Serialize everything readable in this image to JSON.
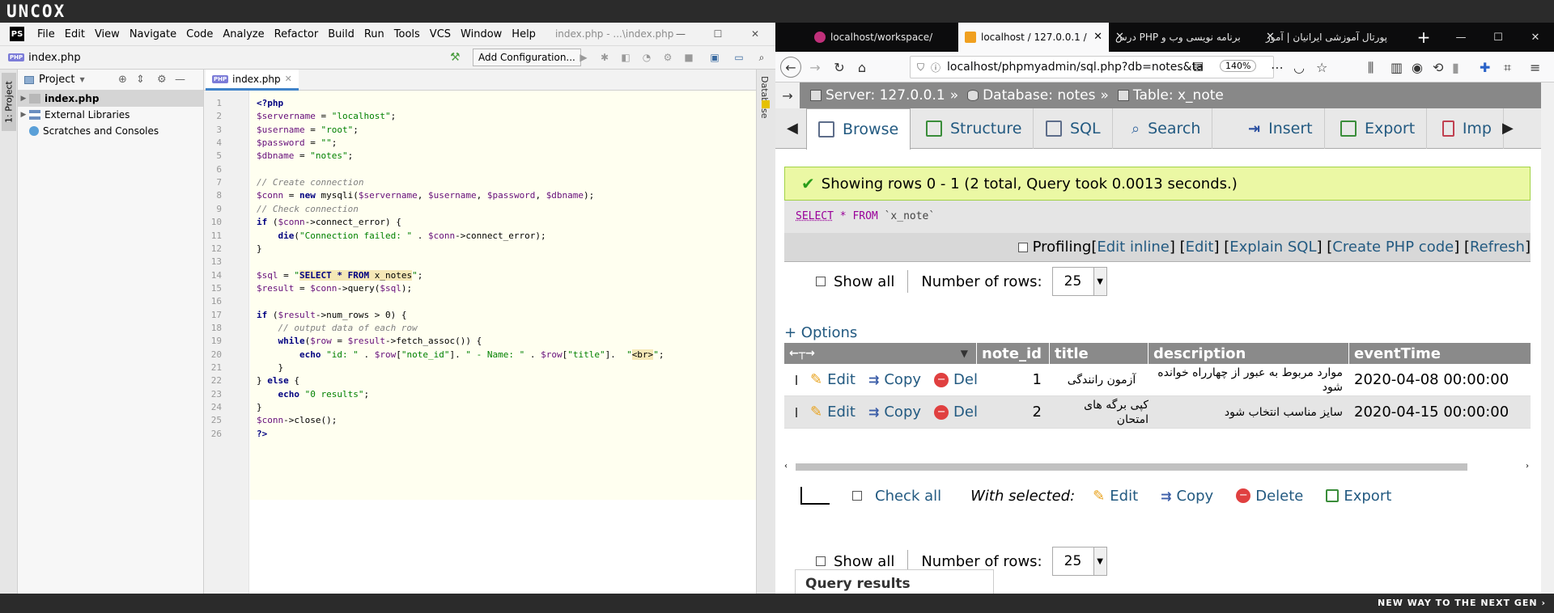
{
  "brand": {
    "logo": "UNCOX",
    "tagline": "NEW WAY TO THE NEXT GEN ›"
  },
  "ide": {
    "menu": [
      "File",
      "Edit",
      "View",
      "Navigate",
      "Code",
      "Analyze",
      "Refactor",
      "Build",
      "Run",
      "Tools",
      "VCS",
      "Window",
      "Help"
    ],
    "title": "index.php - ...\\index.php",
    "breadcrumb_file": "index.php",
    "add_config_label": "Add Configuration...",
    "side_tab_label": "1: Project",
    "project_header": "Project",
    "tree": [
      "index.php",
      "External Libraries",
      "Scratches and Consoles"
    ],
    "editor_tab": "index.php",
    "right_tab_label": "Database",
    "php_badge": "PHP",
    "code_lines": [
      "<?php",
      "$servername = \"localhost\";",
      "$username = \"root\";",
      "$password = \"\";",
      "$dbname = \"notes\";",
      "",
      "// Create connection",
      "$conn = new mysqli($servername, $username, $password, $dbname);",
      "// Check connection",
      "if ($conn->connect_error) {",
      "    die(\"Connection failed: \" . $conn->connect_error);",
      "}",
      "",
      "$sql = \"SELECT * FROM x_notes\";",
      "$result = $conn->query($sql);",
      "",
      "if ($result->num_rows > 0) {",
      "    // output data of each row",
      "    while($row = $result->fetch_assoc()) {",
      "        echo \"id: \" . $row[\"note_id\"]. \" - Name: \" . $row[\"title\"].  \"<br>\";",
      "    }",
      "} else {",
      "    echo \"0 results\";",
      "}",
      "$conn->close();",
      "?>"
    ]
  },
  "browser": {
    "tabs": [
      {
        "label": "localhost/workspace/",
        "active": false
      },
      {
        "label": "localhost / 127.0.0.1 /",
        "active": true
      },
      {
        "label": "برنامه نویسی وب و PHP درس",
        "active": false
      },
      {
        "label": "پورتال آموزشی ایرانیان | آموز",
        "active": false
      }
    ],
    "url": "localhost/phpmyadmin/sql.php?db=notes&ta",
    "zoom": "140%"
  },
  "pma": {
    "breadcrumb": {
      "server": "Server: 127.0.0.1",
      "database": "Database: notes",
      "table": "Table: x_note",
      "separator": "»"
    },
    "tabs": [
      "Browse",
      "Structure",
      "SQL",
      "Search",
      "Insert",
      "Export",
      "Imp"
    ],
    "success_message": "Showing rows 0 - 1 (2 total, Query took 0.0013 seconds.)",
    "sql": {
      "select": "SELECT",
      "star": "*",
      "from": "FROM",
      "table": "`x_note`"
    },
    "profiling": {
      "label": "Profiling",
      "links": [
        "Edit inline",
        "Edit",
        "Explain SQL",
        "Create PHP code",
        "Refresh"
      ]
    },
    "show_all": "Show all",
    "number_of_rows_label": "Number of rows:",
    "number_of_rows_value": "25",
    "options_link": "+ Options",
    "columns": [
      "note_id",
      "title",
      "description",
      "eventTime"
    ],
    "row_actions": {
      "edit": "Edit",
      "copy": "Copy",
      "delete": "Delete"
    },
    "rows": [
      {
        "note_id": "1",
        "title": "آزمون رانندگی",
        "description": "موارد مربوط به عبور از چهارراه خوانده شود",
        "eventTime": "2020-04-08 00:00:00"
      },
      {
        "note_id": "2",
        "title": "کپی برگه های امتحان",
        "description": "سایز مناسب انتخاب شود",
        "eventTime": "2020-04-15 00:00:00"
      }
    ],
    "check_all": "Check all",
    "with_selected": "With selected:",
    "bulk": {
      "edit": "Edit",
      "copy": "Copy",
      "delete": "Delete",
      "export": "Export"
    },
    "query_results_operations": "Query results operations"
  },
  "colors": {
    "pma_link": "#235a81",
    "success_bg": "#ebf8a4",
    "ide_bg": "#f2f2f2"
  }
}
